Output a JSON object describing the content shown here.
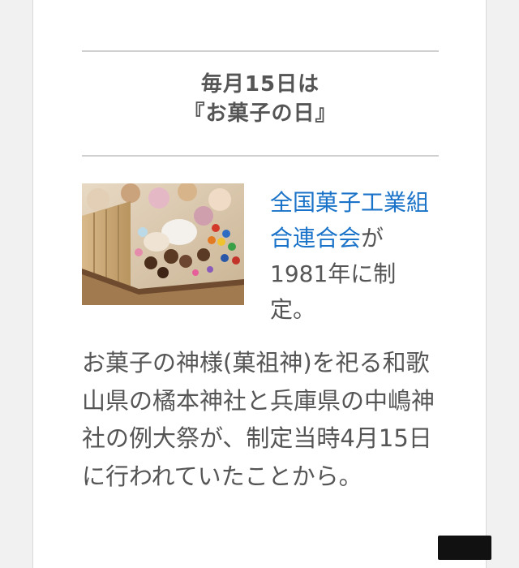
{
  "heading": {
    "line1": "毎月15日は",
    "line2": "『お菓子の日』"
  },
  "side": {
    "link_text": "全国菓子工業組合連合会",
    "text_after_link": "が1981年に制定。"
  },
  "body_text": "お菓子の神様(菓祖神)を祀る和歌山県の橘本神社と兵庫県の中嶋神社の例大祭が、制定当時4月15日に行われていたことから。",
  "colors": {
    "text": "#555555",
    "link": "#1a73c8",
    "rule": "#d0d0d0"
  }
}
